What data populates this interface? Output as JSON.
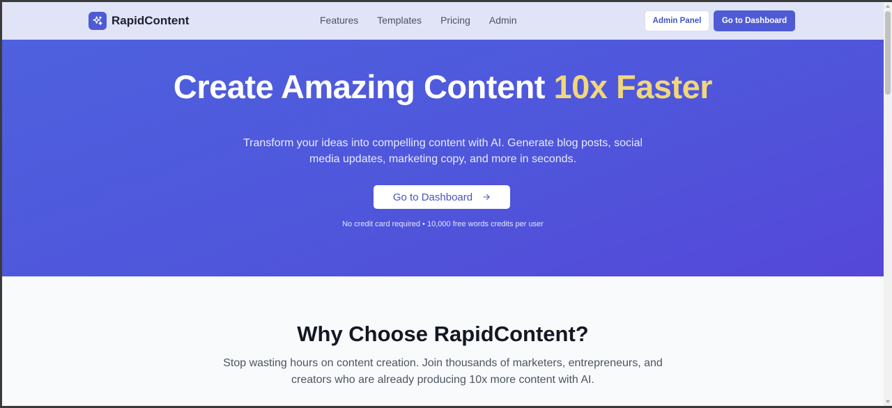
{
  "brand": {
    "name": "RapidContent",
    "logo_icon": "sparkles-icon"
  },
  "nav": {
    "links": [
      "Features",
      "Templates",
      "Pricing",
      "Admin"
    ],
    "admin_panel_label": "Admin Panel",
    "dashboard_label": "Go to Dashboard"
  },
  "hero": {
    "title_main": "Create Amazing Content ",
    "title_accent": "10x Faster",
    "subtitle": "Transform your ideas into compelling content with AI. Generate blog posts, social media updates, marketing copy, and more in seconds.",
    "cta_label": "Go to Dashboard",
    "cta_icon": "arrow-right-icon",
    "note": "No credit card required • 10,000 free words credits per user"
  },
  "why": {
    "title": "Why Choose RapidContent?",
    "subtitle": "Stop wasting hours on content creation. Join thousands of marketers, entrepreneurs, and creators who are already producing 10x more content with AI."
  },
  "colors": {
    "primary": "#4f5bd5",
    "accent_yellow": "#f1d77a",
    "navbar_bg": "#e1e4f7",
    "section_bg": "#f8fafc"
  }
}
